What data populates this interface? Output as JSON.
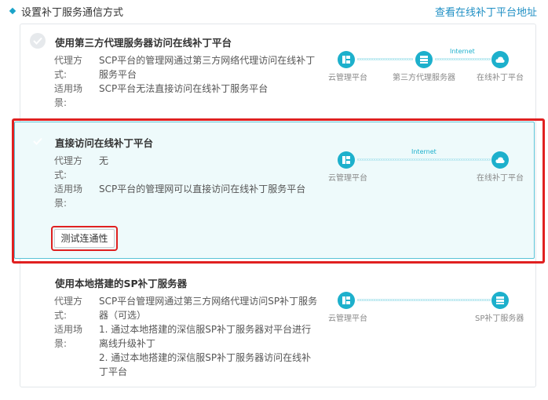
{
  "header": {
    "title": "设置补丁服务通信方式",
    "link": "查看在线补丁平台地址"
  },
  "options": [
    {
      "title": "使用第三方代理服务器访问在线补丁平台",
      "proxy_label": "代理方式:",
      "proxy_value": "SCP平台的管理网通过第三方网络代理访问在线补丁服务平台",
      "scene_label": "适用场景:",
      "scene_value": "SCP平台无法直接访问在线补丁服务平台",
      "diagram": {
        "internet": "Internet",
        "node1": "云管理平台",
        "node2": "第三方代理服务器",
        "node3": "在线补丁平台"
      }
    },
    {
      "title": "直接访问在线补丁平台",
      "proxy_label": "代理方式:",
      "proxy_value": "无",
      "scene_label": "适用场景:",
      "scene_value": "SCP平台的管理网可以直接访问在线补丁服务平台",
      "button": "测试连通性",
      "diagram": {
        "internet": "Internet",
        "node1": "云管理平台",
        "node3": "在线补丁平台"
      }
    },
    {
      "title": "使用本地搭建的SP补丁服务器",
      "proxy_label": "代理方式:",
      "proxy_value": "SCP平台管理网通过第三方网络代理访问SP补丁服务器（可选）",
      "scene_label": "适用场景:",
      "scene_value_1": "1. 通过本地搭建的深信服SP补丁服务器对平台进行离线升级补丁",
      "scene_value_2": "2. 通过本地搭建的深信服SP补丁服务器访问在线补丁平台",
      "diagram": {
        "node1": "云管理平台",
        "node3": "SP补丁服务器"
      }
    }
  ],
  "colors": {
    "accent": "#1db0cc",
    "link": "#1f8fc4",
    "highlight": "#e02020",
    "selected_bg": "#eefafb"
  }
}
